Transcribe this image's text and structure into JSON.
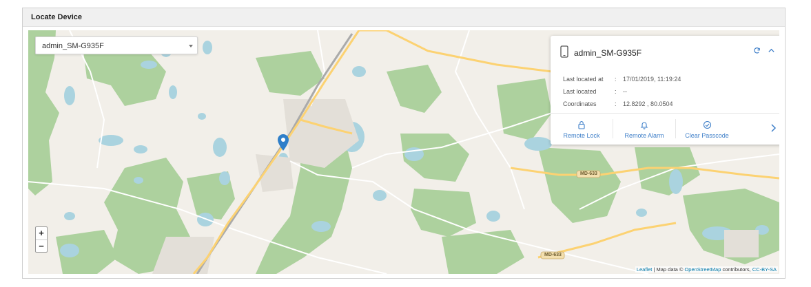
{
  "panel": {
    "title": "Locate Device"
  },
  "device_select": {
    "value": "admin_SM-G935F"
  },
  "card": {
    "device_name": "admin_SM-G935F",
    "rows": [
      {
        "label": "Last located at",
        "value": "17/01/2019, 11:19:24"
      },
      {
        "label": "Last located",
        "value": "--"
      },
      {
        "label": "Coordinates",
        "value": "12.8292 , 80.0504"
      }
    ],
    "actions": [
      {
        "label": "Remote Lock",
        "icon": "lock-icon"
      },
      {
        "label": "Remote Alarm",
        "icon": "bell-icon"
      },
      {
        "label": "Clear Passcode",
        "icon": "check-circle-icon"
      }
    ]
  },
  "map": {
    "zoom_in": "+",
    "zoom_out": "−",
    "road_labels": [
      "MD-633",
      "MD-633"
    ],
    "attribution": {
      "leaflet": "Leaflet",
      "sep": " | Map data © ",
      "osm": "OpenStreetMap",
      "contrib": " contributors, ",
      "license": "CC-BY-SA"
    }
  },
  "colors": {
    "accent": "#3d7ec8",
    "water": "#aad3df",
    "park": "#add19e",
    "road_major": "#fcd272",
    "marker": "#2f7fc9"
  }
}
